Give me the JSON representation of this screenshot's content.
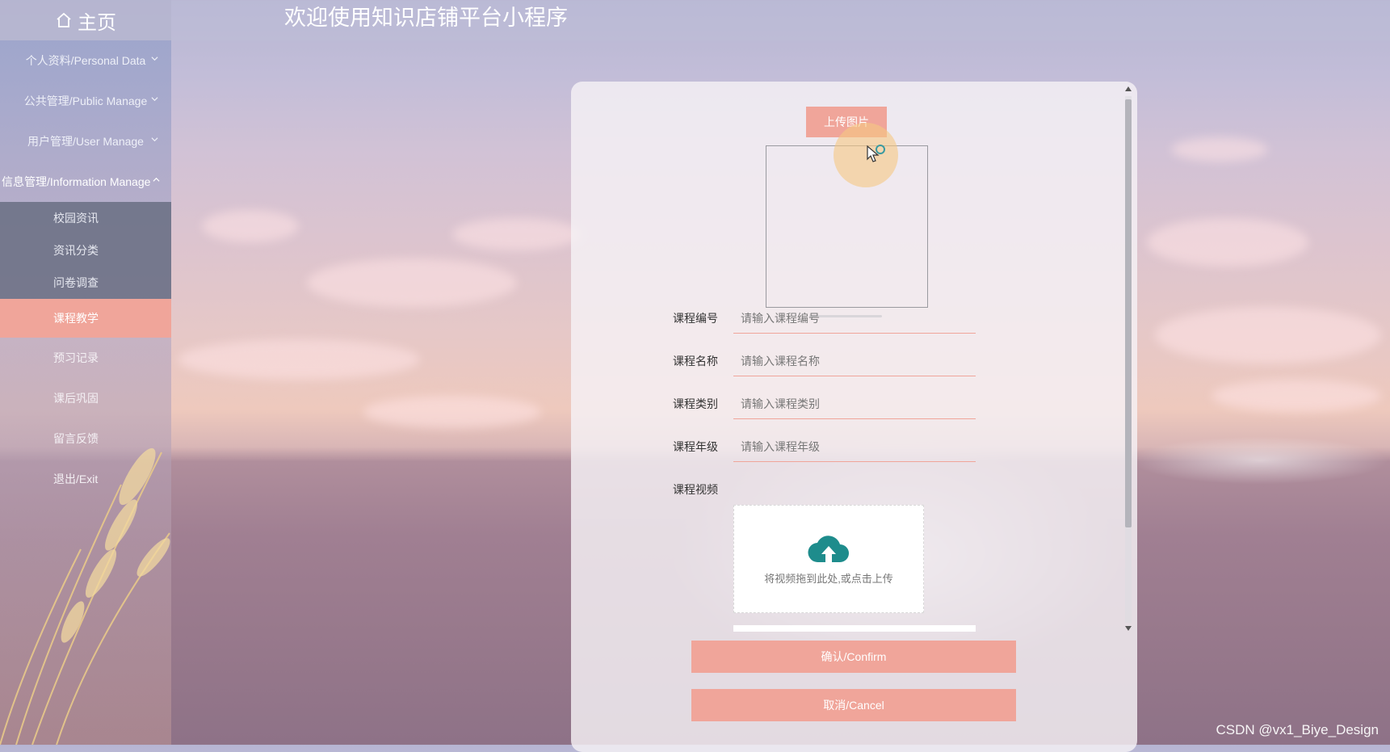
{
  "header": {
    "home_label": "主页",
    "title": "欢迎使用知识店铺平台小程序"
  },
  "sidebar": {
    "menus": [
      {
        "label": "个人资料/Personal Data",
        "expanded": false
      },
      {
        "label": "公共管理/Public Manage",
        "expanded": false
      },
      {
        "label": "用户管理/User Manage",
        "expanded": false
      },
      {
        "label": "信息管理/Information Manage",
        "expanded": true
      }
    ],
    "sub_items": [
      "校园资讯",
      "资讯分类",
      "问卷调查",
      "课程教学"
    ],
    "active_sub": "课程教学",
    "plain_items": [
      "预习记录",
      "课后巩固",
      "留言反馈",
      "退出/Exit"
    ]
  },
  "form": {
    "upload_label": "上传图片",
    "fields": [
      {
        "label": "课程编号",
        "placeholder": "请输入课程编号"
      },
      {
        "label": "课程名称",
        "placeholder": "请输入课程名称"
      },
      {
        "label": "课程类别",
        "placeholder": "请输入课程类别"
      },
      {
        "label": "课程年级",
        "placeholder": "请输入课程年级"
      }
    ],
    "video_label": "课程视频",
    "video_hint": "将视频拖到此处,或点击上传",
    "confirm_label": "确认/Confirm",
    "cancel_label": "取消/Cancel"
  },
  "watermark": "CSDN @vx1_Biye_Design",
  "colors": {
    "accent": "#f0a59a",
    "upload_icon": "#1e8c8c",
    "submenu_bg": "#696e82"
  }
}
